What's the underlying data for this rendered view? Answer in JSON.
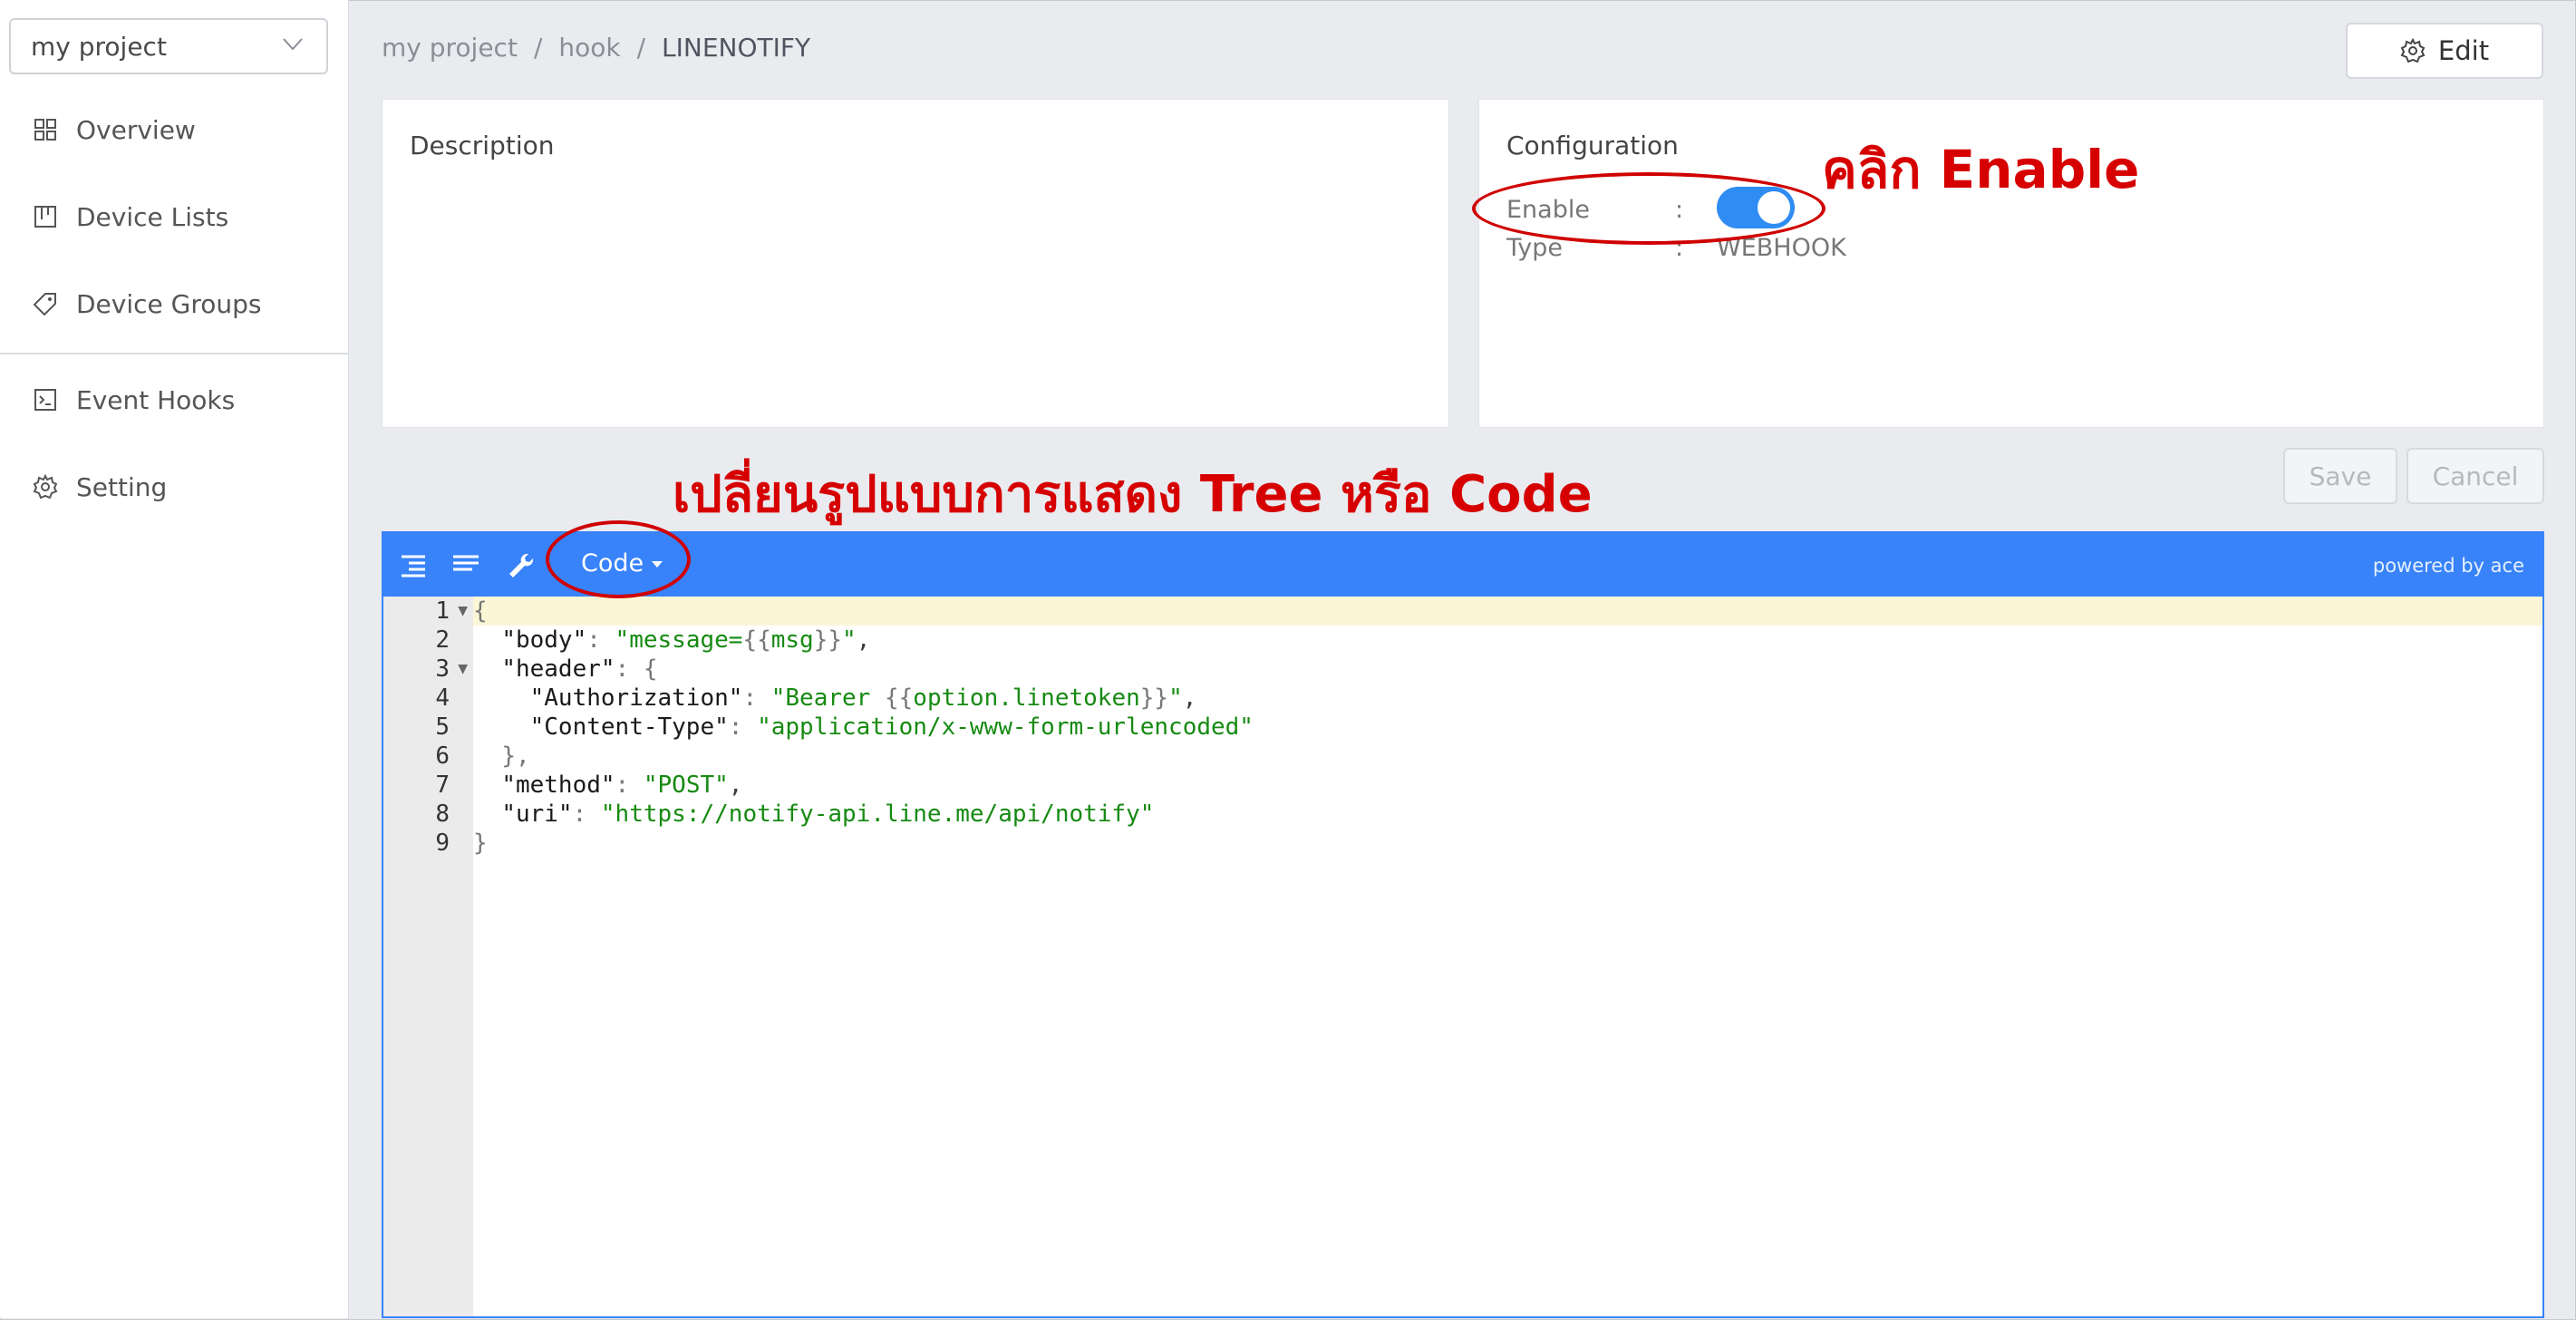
{
  "sidebar": {
    "project": "my project",
    "items": [
      {
        "label": "Overview",
        "icon": "grid-icon"
      },
      {
        "label": "Device Lists",
        "icon": "board-icon"
      },
      {
        "label": "Device Groups",
        "icon": "tag-icon"
      },
      {
        "label": "Event Hooks",
        "icon": "terminal-icon"
      },
      {
        "label": "Setting",
        "icon": "gear-icon"
      }
    ]
  },
  "header": {
    "breadcrumb": [
      "my project",
      "hook",
      "LINENOTIFY"
    ],
    "separator": "/",
    "edit_label": "Edit"
  },
  "description": {
    "title": "Description"
  },
  "configuration": {
    "title": "Configuration",
    "enable_label": "Enable",
    "enable_value": true,
    "type_label": "Type",
    "type_value": "WEBHOOK",
    "colon": ":"
  },
  "actions": {
    "save": "Save",
    "cancel": "Cancel"
  },
  "editor": {
    "mode": "Code",
    "powered_by": "powered by ace",
    "accent": "#3883fa",
    "lines": [
      "{",
      "  \"body\": \"message={{msg}}\",",
      "  \"header\": {",
      "    \"Authorization\": \"Bearer {{option.linetoken}}\",",
      "    \"Content-Type\": \"application/x-www-form-urlencoded\"",
      "  },",
      "  \"method\": \"POST\",",
      "  \"uri\": \"https://notify-api.line.me/api/notify\"",
      "}"
    ]
  },
  "annotations": {
    "enable_hint": "คลิก Enable",
    "mode_hint": "เปลี่ยนรูปแบบการแสดง Tree หรือ Code",
    "color": "#d60000"
  }
}
